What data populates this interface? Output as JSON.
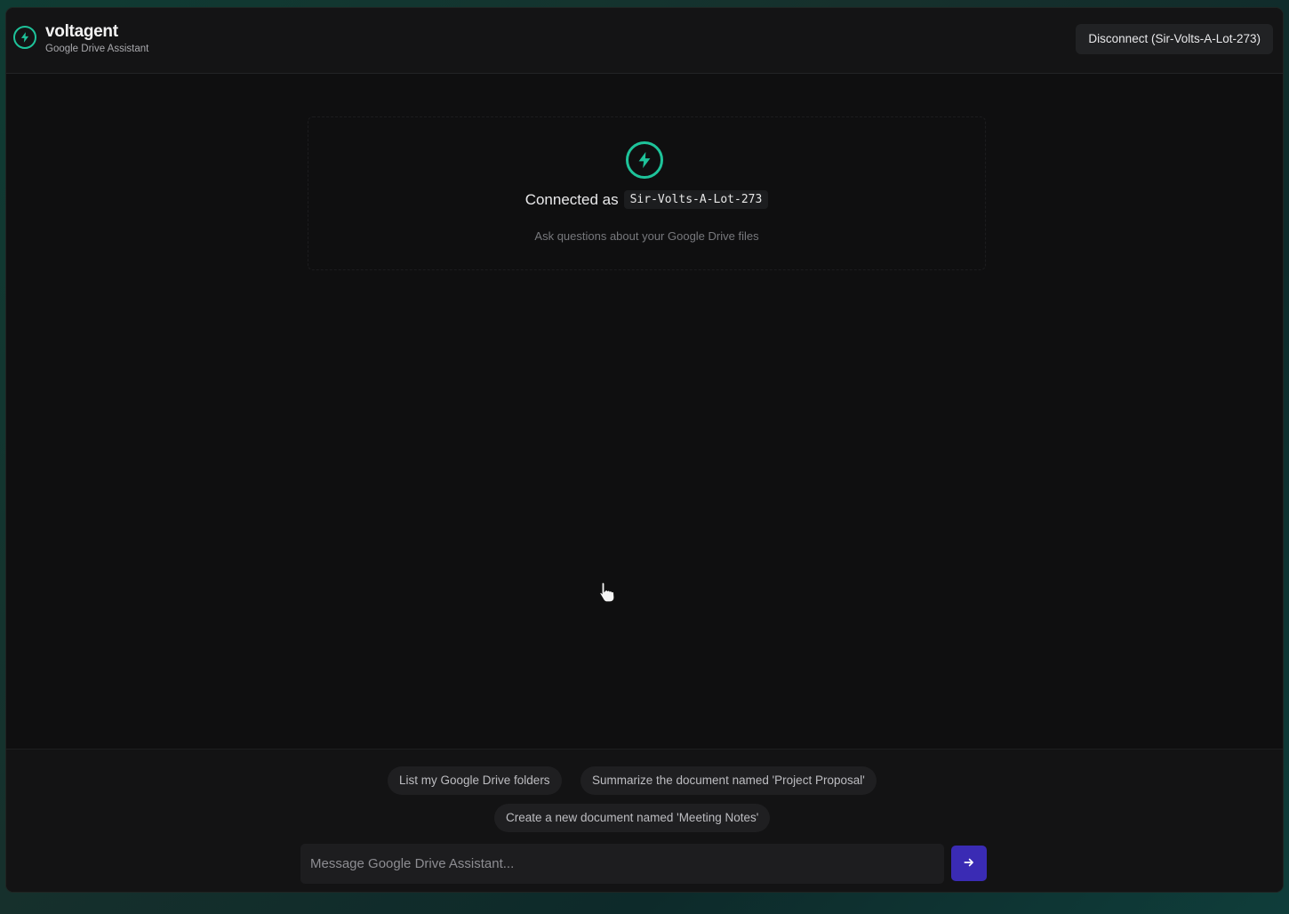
{
  "header": {
    "brand_name": "voltagent",
    "brand_subtitle": "Google Drive Assistant",
    "disconnect_label": "Disconnect (Sir-Volts-A-Lot-273)"
  },
  "welcome": {
    "connected_label": "Connected as",
    "username": "Sir-Volts-A-Lot-273",
    "subtitle": "Ask questions about your Google Drive files"
  },
  "suggestions": [
    "List my Google Drive folders",
    "Summarize the document named 'Project Proposal'",
    "Create a new document named 'Meeting Notes'"
  ],
  "composer": {
    "placeholder": "Message Google Drive Assistant...",
    "value": ""
  },
  "icons": {
    "brand": "bolt-icon",
    "welcome": "bolt-icon",
    "send": "arrow-right-icon"
  },
  "colors": {
    "accent": "#1ec39a",
    "send_button": "#3a2bb4"
  }
}
